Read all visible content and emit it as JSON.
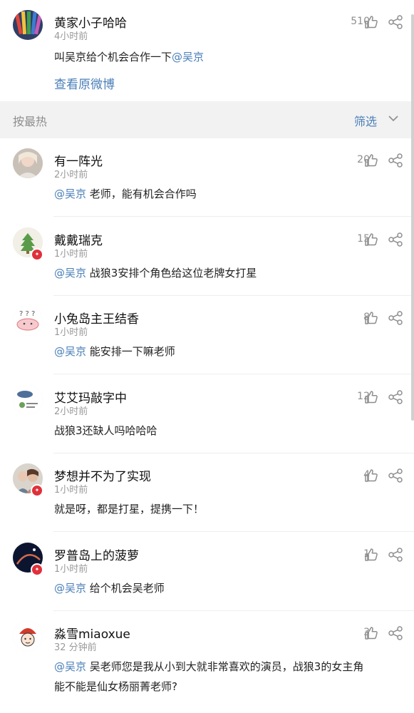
{
  "post": {
    "author": "黄家小子哈哈",
    "time": "4小时前",
    "text_prefix": "叫吴京给个机会合作一下",
    "mention": "@吴京",
    "likes": "510",
    "view_original": "查看原微博"
  },
  "sort": {
    "label": "按最热",
    "filter": "筛选"
  },
  "comments": [
    {
      "name": "有一阵光",
      "time": "2小时前",
      "mention": "@吴京",
      "text": " 老师，能有机会合作吗",
      "likes": "20",
      "verified": false
    },
    {
      "name": "戴戴瑞克",
      "time": "1小时前",
      "mention": "@吴京",
      "text": " 战狼3安排个角色给这位老牌女打星",
      "likes": "15",
      "verified": true
    },
    {
      "name": "小兔岛主王结香",
      "time": "1小时前",
      "mention": "@吴京",
      "text": " 能安排一下嘛老师",
      "likes": "8",
      "verified": false
    },
    {
      "name": "艾艾玛敲字中",
      "time": "2小时前",
      "mention": "",
      "text": "战狼3还缺人吗哈哈哈",
      "likes": "12",
      "verified": false
    },
    {
      "name": "梦想并不为了实现",
      "time": "1小时前",
      "mention": "",
      "text": "就是呀，都是打星，提携一下！",
      "likes": "4",
      "verified": true
    },
    {
      "name": "罗普岛上的菠萝",
      "time": "1小时前",
      "mention": "@吴京",
      "text": " 给个机会吴老师",
      "likes": "1",
      "verified": true
    },
    {
      "name": "淼雪miaoxue",
      "time": "32 分钟前",
      "mention": "@吴京",
      "text": " 吴老师您是我从小到大就非常喜欢的演员，战狼3的女主角",
      "text2": "能不能是仙女杨丽菁老师?",
      "likes": "3",
      "verified": false
    }
  ],
  "icons": {
    "like": "thumbs-up-icon",
    "share": "share-icon",
    "chevron": "chevron-down-icon",
    "verified": "verified-badge-icon"
  },
  "colors": {
    "link": "#4a7fb8",
    "badge": "#e0303a",
    "sortbar_bg": "#f2f2f2"
  }
}
